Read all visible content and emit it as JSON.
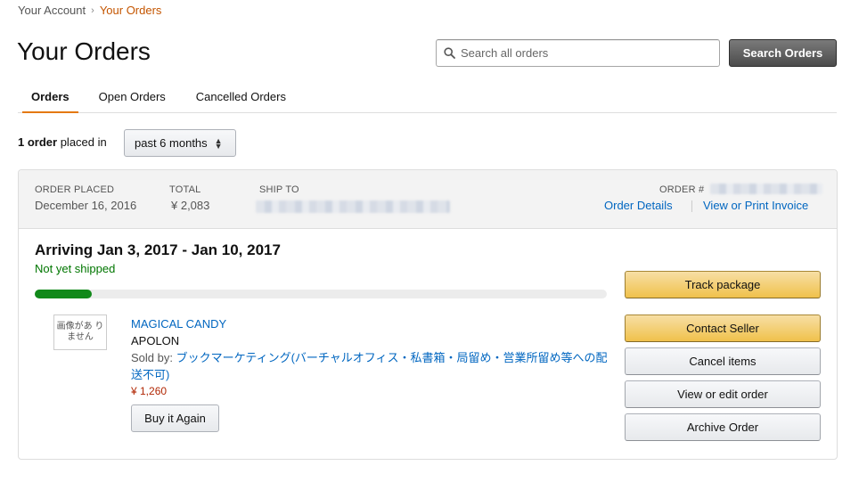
{
  "breadcrumb": {
    "parent": "Your Account",
    "separator": "›",
    "current": "Your Orders"
  },
  "page_title": "Your Orders",
  "search": {
    "placeholder": "Search all orders",
    "value": "",
    "button_label": "Search Orders",
    "icon": "search-icon"
  },
  "tabs": [
    {
      "label": "Orders",
      "active": true
    },
    {
      "label": "Open Orders",
      "active": false
    },
    {
      "label": "Cancelled Orders",
      "active": false
    }
  ],
  "summary": {
    "count": "1 order",
    "text": "placed in",
    "period": "past 6 months"
  },
  "order": {
    "placed_label": "ORDER PLACED",
    "placed_value": "December 16, 2016",
    "total_label": "TOTAL",
    "total_value": "¥ 2,083",
    "ship_to_label": "SHIP TO",
    "order_number_label": "ORDER #",
    "details_link": "Order Details",
    "invoice_link": "View or Print Invoice",
    "arrival": "Arriving Jan 3, 2017 - Jan 10, 2017",
    "status": "Not yet shipped",
    "status_color": "#007600",
    "progress_fraction": 0.1,
    "item": {
      "image_placeholder": "画像があ りません",
      "title": "MAGICAL CANDY",
      "brand": "APOLON",
      "sold_by_label": "Sold by:",
      "seller": "ブックマーケティング(バーチャルオフィス・私書箱・局留め・営業所留め等への配送不可)",
      "price": "¥ 1,260",
      "buy_again_label": "Buy it Again"
    },
    "actions": {
      "track": "Track package",
      "contact": "Contact Seller",
      "cancel": "Cancel items",
      "view_edit": "View or edit order",
      "archive": "Archive Order"
    }
  },
  "colors": {
    "accent": "#e47911",
    "link": "#0066c0",
    "price": "#b12704",
    "primary_button": "#f0c14b"
  }
}
